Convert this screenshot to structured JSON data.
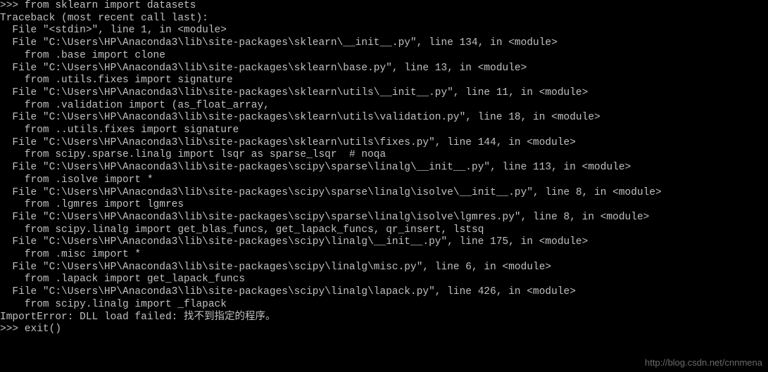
{
  "lines": {
    "l0": ">>> from sklearn import datasets",
    "l1": "Traceback (most recent call last):",
    "l2": "  File \"<stdin>\", line 1, in <module>",
    "l3": "  File \"C:\\Users\\HP\\Anaconda3\\lib\\site-packages\\sklearn\\__init__.py\", line 134, in <module>",
    "l4": "    from .base import clone",
    "l5": "  File \"C:\\Users\\HP\\Anaconda3\\lib\\site-packages\\sklearn\\base.py\", line 13, in <module>",
    "l6": "    from .utils.fixes import signature",
    "l7": "  File \"C:\\Users\\HP\\Anaconda3\\lib\\site-packages\\sklearn\\utils\\__init__.py\", line 11, in <module>",
    "l8": "    from .validation import (as_float_array,",
    "l9": "  File \"C:\\Users\\HP\\Anaconda3\\lib\\site-packages\\sklearn\\utils\\validation.py\", line 18, in <module>",
    "l10": "    from ..utils.fixes import signature",
    "l11": "  File \"C:\\Users\\HP\\Anaconda3\\lib\\site-packages\\sklearn\\utils\\fixes.py\", line 144, in <module>",
    "l12": "    from scipy.sparse.linalg import lsqr as sparse_lsqr  # noqa",
    "l13": "  File \"C:\\Users\\HP\\Anaconda3\\lib\\site-packages\\scipy\\sparse\\linalg\\__init__.py\", line 113, in <module>",
    "l14": "    from .isolve import *",
    "l15": "  File \"C:\\Users\\HP\\Anaconda3\\lib\\site-packages\\scipy\\sparse\\linalg\\isolve\\__init__.py\", line 8, in <module>",
    "l16": "    from .lgmres import lgmres",
    "l17": "  File \"C:\\Users\\HP\\Anaconda3\\lib\\site-packages\\scipy\\sparse\\linalg\\isolve\\lgmres.py\", line 8, in <module>",
    "l18": "    from scipy.linalg import get_blas_funcs, get_lapack_funcs, qr_insert, lstsq",
    "l19": "  File \"C:\\Users\\HP\\Anaconda3\\lib\\site-packages\\scipy\\linalg\\__init__.py\", line 175, in <module>",
    "l20": "    from .misc import *",
    "l21": "  File \"C:\\Users\\HP\\Anaconda3\\lib\\site-packages\\scipy\\linalg\\misc.py\", line 6, in <module>",
    "l22": "    from .lapack import get_lapack_funcs",
    "l23": "  File \"C:\\Users\\HP\\Anaconda3\\lib\\site-packages\\scipy\\linalg\\lapack.py\", line 426, in <module>",
    "l24": "    from scipy.linalg import _flapack",
    "l25": "ImportError: DLL load failed: 找不到指定的程序。",
    "l26": ">>> exit()"
  },
  "watermark": "http://blog.csdn.net/cnnmena"
}
